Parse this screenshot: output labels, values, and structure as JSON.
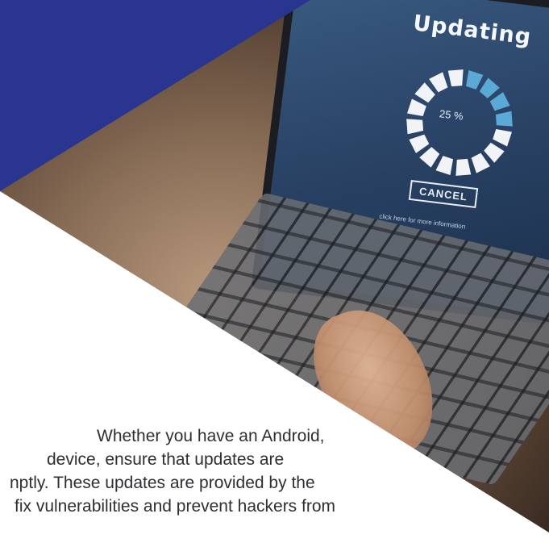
{
  "screen": {
    "title": "Updating",
    "progress_percent_label": "25 %",
    "progress_value": 0.25,
    "cancel_label": "CANCEL",
    "hint": "click here for more information"
  },
  "article": {
    "lines": [
      "Whether you have an Android,",
      "device, ensure that updates are",
      "nptly. These updates are provided by the",
      "fix vulnerabilities and prevent hackers from"
    ]
  },
  "colors": {
    "accent_blue": "#2a3590",
    "progress_blue": "#5aa9d6",
    "progress_white": "#f1f3f6"
  }
}
